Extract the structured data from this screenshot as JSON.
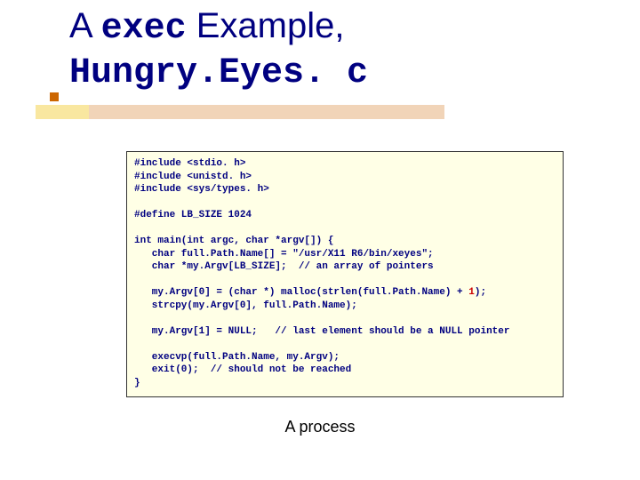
{
  "title": {
    "pre": "A ",
    "mono1": "exec",
    "mid": " Example, ",
    "mono2": "Hungry.Eyes. c"
  },
  "code_lines": [
    "#include <stdio. h>",
    "#include <unistd. h>",
    "#include <sys/types. h>",
    "",
    "#define LB_SIZE 1024",
    "",
    "int main(int argc, char *argv[]) {",
    "   char full.Path.Name[] = \"/usr/X11 R6/bin/xeyes\";",
    "   char *my.Argv[LB_SIZE];  // an array of pointers",
    "",
    "   my.Argv[0] = (char *) malloc(strlen(full.Path.Name) + ",
    "1",
    ");",
    "   strcpy(my.Argv[0], full.Path.Name);",
    "",
    "   my.Argv[1] = NULL;   // last element should be a NULL pointer",
    "",
    "   execvp(full.Path.Name, my.Argv);",
    "   exit(0);  // should not be reached",
    "}"
  ],
  "caption": "A process"
}
